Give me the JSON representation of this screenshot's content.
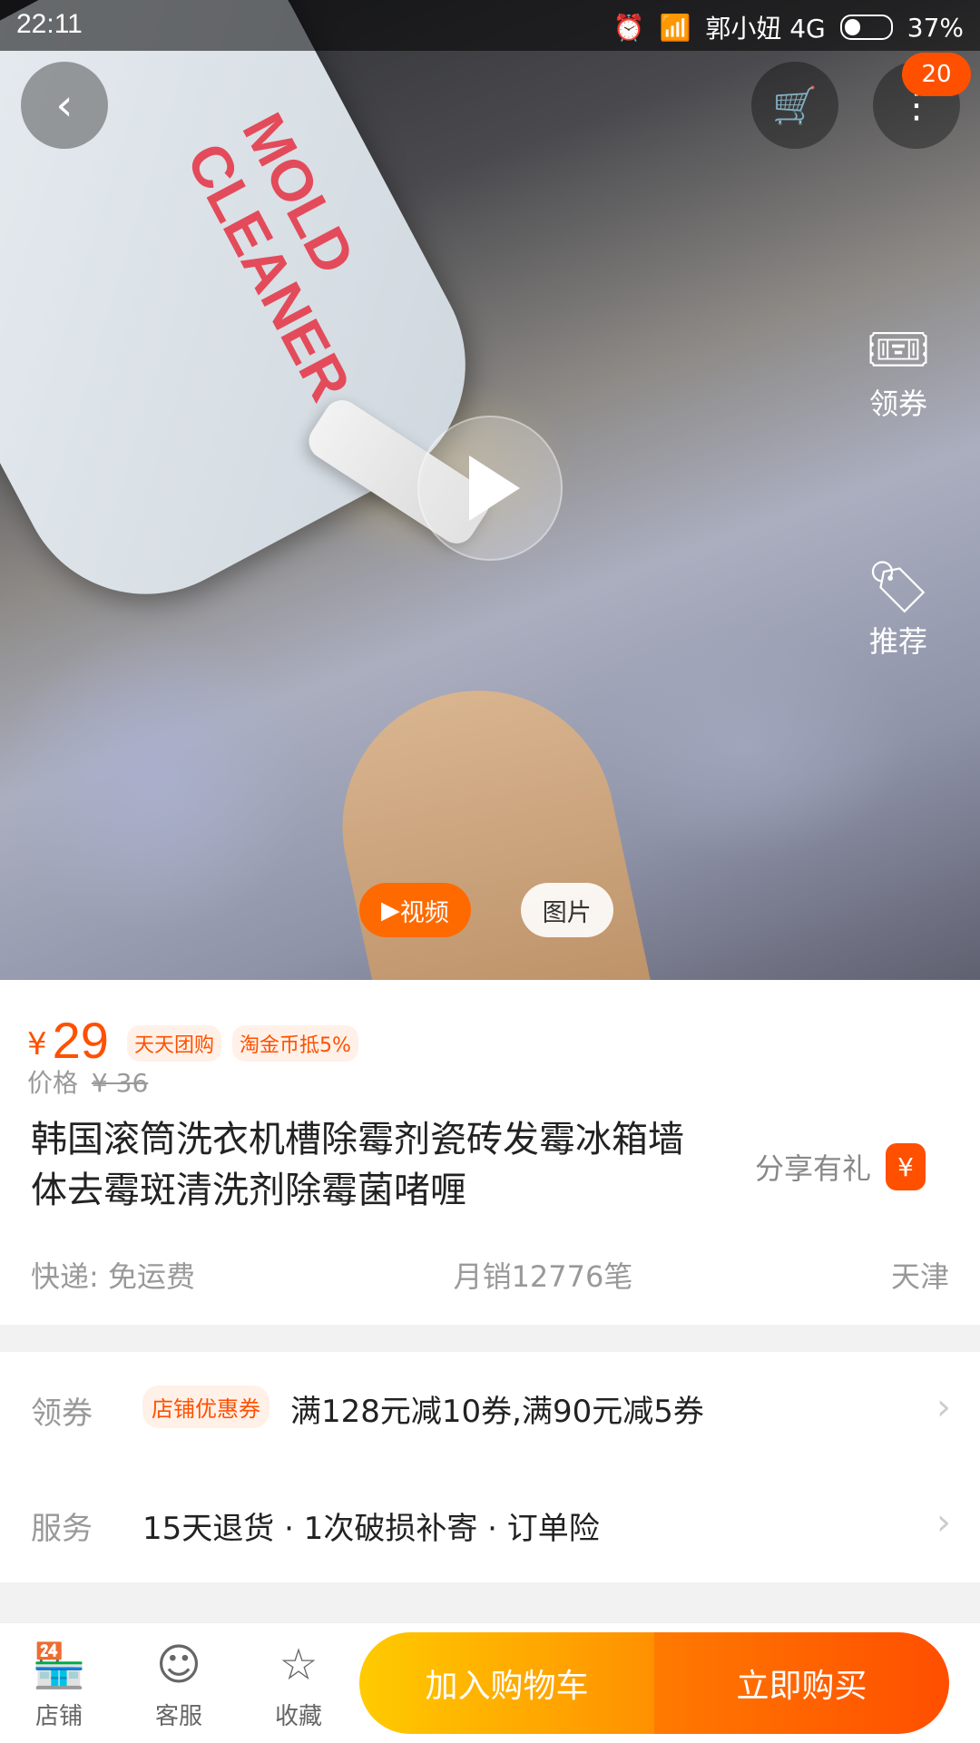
{
  "status_bar": {
    "time": "22:11",
    "carrier": "郭小妞 4G",
    "battery_percent": "37%",
    "battery_level": 0.37
  },
  "top_nav": {
    "back_icon": "chevron-left-icon",
    "cart_icon": "cart-icon",
    "more_icon": "more-vertical-icon",
    "badge_count": "20"
  },
  "hero": {
    "bottle_text": "MOLD CLEANER",
    "side_actions": [
      {
        "label": "领券",
        "icon": "ticket-icon"
      },
      {
        "label": "推荐",
        "icon": "tag-icon"
      }
    ],
    "media_tabs": [
      {
        "label": "视频",
        "icon": "play-icon",
        "active": true
      },
      {
        "label": "图片",
        "active": false
      }
    ]
  },
  "product": {
    "price_symbol": "¥",
    "price": "29",
    "tags": [
      "天天团购",
      "淘金币抵5%"
    ],
    "original_price_label": "价格",
    "original_price": "¥ 36",
    "title": "韩国滚筒洗衣机槽除霉剂瓷砖发霉冰箱墙体去霉斑清洗剂除霉菌啫喱",
    "share_label": "分享有礼",
    "share_icon_text": "¥",
    "shipping": "快递: 免运费",
    "monthly_sales": "月销12776笔",
    "location": "天津"
  },
  "coupon": {
    "label": "领券",
    "tag": "店铺优惠券",
    "text": "满128元减10券,满90元减5券"
  },
  "service": {
    "label": "服务",
    "text": "15天退货  ·  1次破损补寄  ·  订单险"
  },
  "bottom_bar": {
    "items": [
      {
        "label": "店铺",
        "icon": "store-icon"
      },
      {
        "label": "客服",
        "icon": "customer-service-icon"
      },
      {
        "label": "收藏",
        "icon": "star-icon"
      }
    ],
    "add_to_cart": "加入购物车",
    "buy_now": "立即购买"
  },
  "colors": {
    "accent": "#ff5000",
    "cta_yellow": "#ffcb00",
    "cta_orange": "#ff4e00",
    "muted_text": "#999999"
  }
}
